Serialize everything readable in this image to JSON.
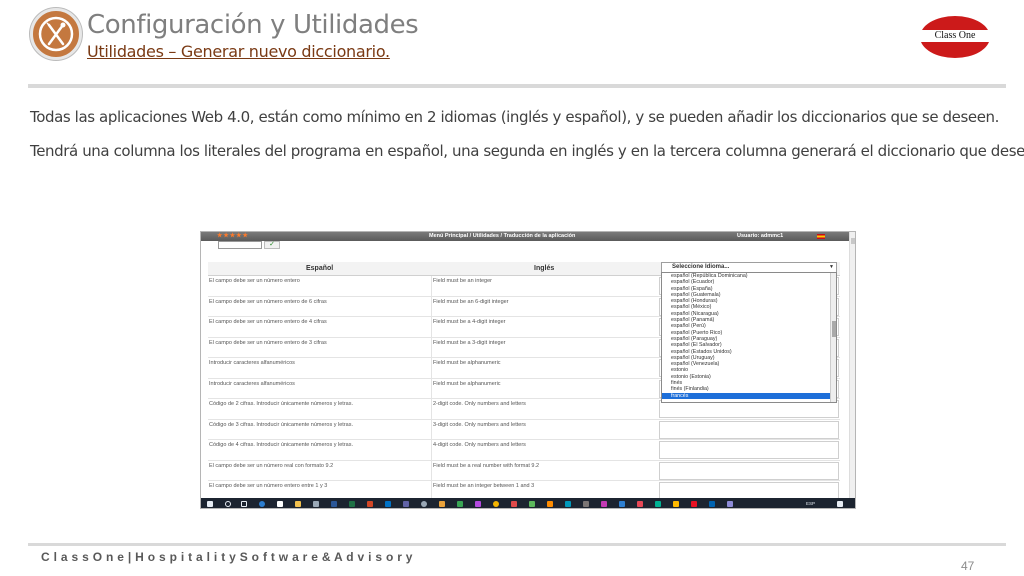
{
  "header": {
    "title": "Configuración y Utilidades",
    "subtitle": "Utilidades – Generar nuevo diccionario.",
    "brand": "Class One",
    "logo_icon": "fork-knife-icon"
  },
  "body": {
    "paragraph_1": "Todas las aplicaciones Web 4.0, están como mínimo en 2 idiomas (inglés y español), y se pueden añadir los diccionarios que se deseen.",
    "paragraph_2": "Tendrá una columna los literales del programa en español, una segunda en inglés y en la tercera columna generará el diccionario que desee"
  },
  "screenshot": {
    "menubar": {
      "stars": "★★★★★",
      "breadcrumb": "Menú Principal  /  Utilidades  /  Traducción de la aplicación",
      "user": "Usuario: admmc1"
    },
    "check_icon": "✓",
    "columns": {
      "spanish": "Español",
      "english": "Inglés"
    },
    "language_select": {
      "placeholder": "Seleccione Idioma...",
      "options": [
        "español (República Dominicana)",
        "español (Ecuador)",
        "español (España)",
        "español (Guatemala)",
        "español (Honduras)",
        "español (México)",
        "español (Nicaragua)",
        "español (Panamá)",
        "español (Perú)",
        "español (Puerto Rico)",
        "español (Paraguay)",
        "español (El Salvador)",
        "español (Estados Unidos)",
        "español (Uruguay)",
        "español (Venezuela)",
        "estonio",
        "estonio (Estonia)",
        "finés",
        "finés (Finlandia)",
        "francés"
      ],
      "selected": "francés"
    },
    "rows": [
      {
        "es": "El campo debe ser un número entero",
        "en": "Field must be an integer"
      },
      {
        "es": "El campo debe ser un número entero de 6 cifras",
        "en": "Field must be an 6-digit integer"
      },
      {
        "es": "El campo debe ser un número entero de 4 cifras",
        "en": "Field must be a 4-digit integer"
      },
      {
        "es": "El campo debe ser un número entero de 3 cifras",
        "en": "Field must be a 3-digit integer"
      },
      {
        "es": "Introducir caracteres alfanuméricos",
        "en": "Field must be alphanumeric"
      },
      {
        "es": "Introducir caracteres alfanuméricos",
        "en": "Field must be alphanumeric"
      },
      {
        "es": "Código de 2 cifras. Introducir únicamente números y letras.",
        "en": "2-digit code. Only numbers and letters"
      },
      {
        "es": "Código de 3 cifras. Introducir únicamente números y letras.",
        "en": "3-digit code. Only numbers and letters"
      },
      {
        "es": "Código de 4 cifras. Introducir únicamente números y letras.",
        "en": "4-digit code. Only numbers and letters"
      },
      {
        "es": "El campo debe ser un número real con formato 9.2",
        "en": "Field must be a real number with format 9.2"
      },
      {
        "es": "El campo debe ser un número entero entre 1 y 3",
        "en": "Field must be an integer between 1 and 3"
      }
    ],
    "taskbar": {
      "lang": "ESP"
    }
  },
  "footer": {
    "company": "C l a s s O n e | H o s p i t a l i t y S o f t w a r e & A d v i s o r y",
    "page": "47"
  }
}
